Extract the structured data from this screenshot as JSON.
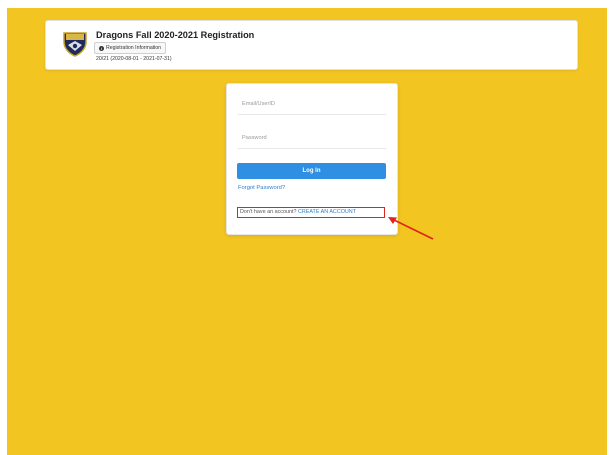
{
  "header": {
    "title": "Dragons Fall 2020-2021 Registration",
    "info_button_label": "Registration Information",
    "season": "20/21 (2020-08-01 - 2021-07-31)",
    "crest_icon": "team-crest-icon"
  },
  "login": {
    "email_placeholder": "Email/UserID",
    "password_placeholder": "Password",
    "login_button": "Log In",
    "forgot_password": "Forgot Password?",
    "no_account_text": "Don't have an account?",
    "create_account_link": "CREATE AN ACCOUNT"
  },
  "annotation": {
    "highlight_color": "#e0231b",
    "arrow_color": "#e0231b"
  },
  "colors": {
    "background": "#f2c521",
    "primary": "#2f8fe3",
    "link": "#2f7fd0"
  }
}
